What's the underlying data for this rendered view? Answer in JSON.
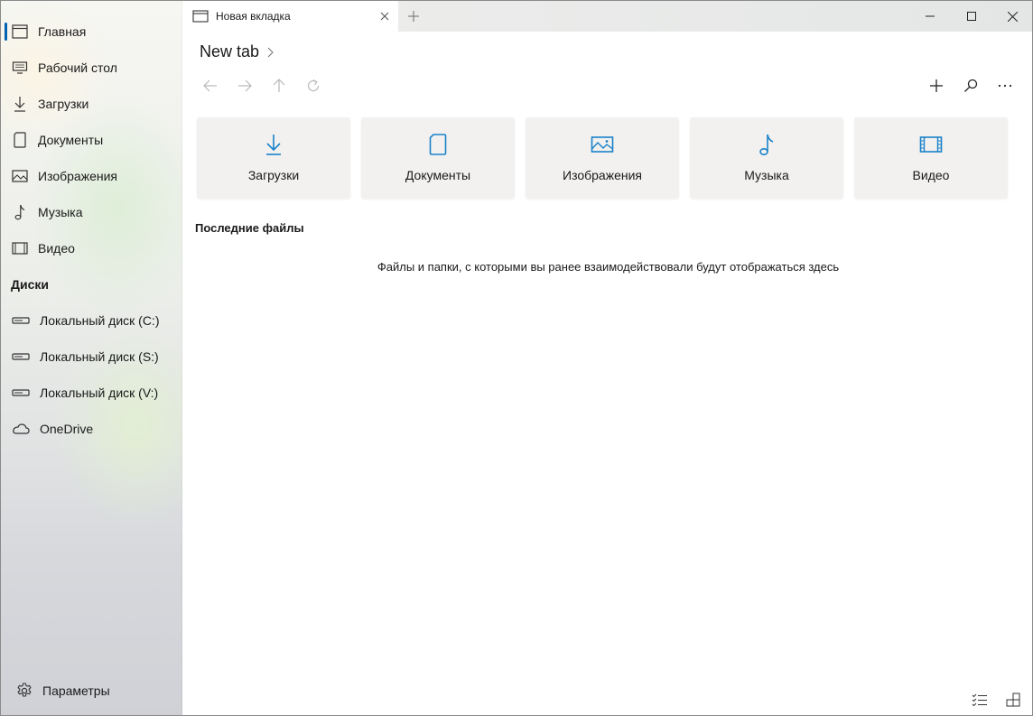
{
  "sidebar": {
    "items": [
      {
        "label": "Главная",
        "icon": "home-icon"
      },
      {
        "label": "Рабочий стол",
        "icon": "desktop-icon"
      },
      {
        "label": "Загрузки",
        "icon": "download-icon"
      },
      {
        "label": "Документы",
        "icon": "document-icon"
      },
      {
        "label": "Изображения",
        "icon": "image-icon"
      },
      {
        "label": "Музыка",
        "icon": "music-icon"
      },
      {
        "label": "Видео",
        "icon": "video-icon"
      }
    ],
    "drives_header": "Диски",
    "drives": [
      {
        "label": "Локальный диск (C:)",
        "icon": "drive-icon"
      },
      {
        "label": "Локальный диск (S:)",
        "icon": "drive-icon"
      },
      {
        "label": "Локальный диск (V:)",
        "icon": "drive-icon"
      },
      {
        "label": "OneDrive",
        "icon": "cloud-icon"
      }
    ],
    "settings_label": "Параметры"
  },
  "tab": {
    "title": "Новая вкладка"
  },
  "breadcrumb": {
    "title": "New tab"
  },
  "cards": [
    {
      "label": "Загрузки",
      "icon": "download-icon"
    },
    {
      "label": "Документы",
      "icon": "document-icon"
    },
    {
      "label": "Изображения",
      "icon": "image-icon"
    },
    {
      "label": "Музыка",
      "icon": "music-icon"
    },
    {
      "label": "Видео",
      "icon": "video-icon"
    }
  ],
  "recent": {
    "title": "Последние файлы",
    "empty_message": "Файлы и папки, с которыми вы ранее взаимодействовали будут отображаться здесь"
  },
  "colors": {
    "accent": "#0063b1",
    "card_icon": "#1a82c9",
    "card_bg": "#f2f1f0"
  }
}
